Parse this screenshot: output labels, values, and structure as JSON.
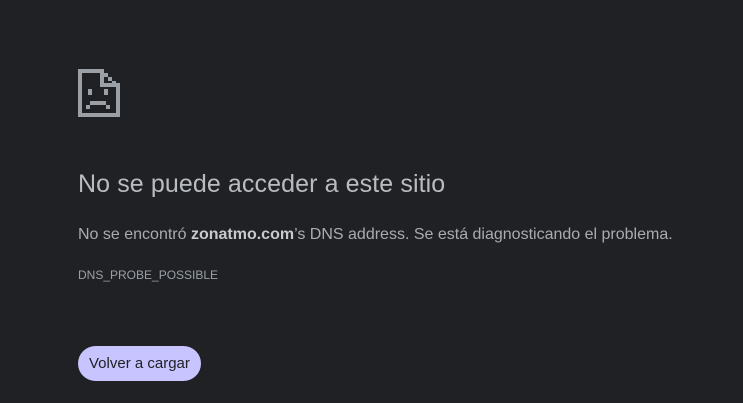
{
  "icon": {
    "name": "sad-document-icon",
    "color": "#9aa0a6"
  },
  "error": {
    "title": "No se puede acceder a este sitio",
    "message_before": "No se encontró ",
    "domain": "zonatmo.com",
    "message_after": "’s DNS address. Se está diagnosticando el problema.",
    "code": "DNS_PROBE_POSSIBLE"
  },
  "actions": {
    "reload_label": "Volver a cargar"
  },
  "colors": {
    "background": "#202124",
    "button": "#c7c4ff",
    "text": "#b8bcc1"
  }
}
